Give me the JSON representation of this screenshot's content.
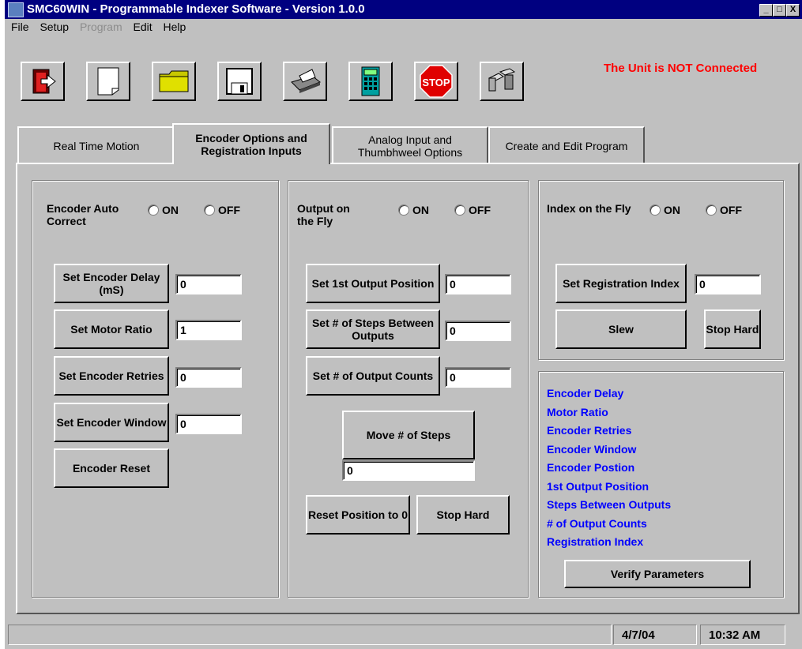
{
  "window": {
    "title": "SMC60WIN - Programmable Indexer Software - Version 1.0.0",
    "controls": [
      "_",
      "□",
      "X"
    ]
  },
  "menu": {
    "items": [
      {
        "label": "File",
        "enabled": true
      },
      {
        "label": "Setup",
        "enabled": true
      },
      {
        "label": "Program",
        "enabled": false
      },
      {
        "label": "Edit",
        "enabled": true
      },
      {
        "label": "Help",
        "enabled": true
      }
    ]
  },
  "toolbar": {
    "buttons": [
      "exit-icon",
      "new-file-icon",
      "open-folder-icon",
      "save-disk-icon",
      "printer-icon",
      "calculator-icon",
      "stop-sign-icon",
      "communication-icon"
    ],
    "stop_text": "STOP"
  },
  "connection_status": "The Unit is NOT Connected",
  "tabs": [
    {
      "label": "Real Time Motion",
      "active": false
    },
    {
      "label": "Encoder Options and Registration Inputs",
      "active": true
    },
    {
      "label": "Analog Input and Thumbhweel Options",
      "active": false
    },
    {
      "label": "Create and Edit Program",
      "active": false
    }
  ],
  "radio_on": "ON",
  "radio_off": "OFF",
  "encoder_panel": {
    "title": "Encoder Auto Correct",
    "buttons": [
      {
        "label": "Set Encoder Delay (mS)",
        "value": "0"
      },
      {
        "label": "Set Motor Ratio",
        "value": "1"
      },
      {
        "label": "Set Encoder Retries",
        "value": "0"
      },
      {
        "label": "Set Encoder Window",
        "value": "0"
      }
    ],
    "reset_label": "Encoder Reset"
  },
  "output_panel": {
    "title": "Output on the Fly",
    "buttons": [
      {
        "label": "Set 1st Output Position",
        "value": "0"
      },
      {
        "label": "Set # of Steps Between Outputs",
        "value": "0"
      },
      {
        "label": "Set # of Output Counts",
        "value": "0"
      }
    ],
    "move_label": "Move # of Steps",
    "move_value": "0",
    "reset_label": "Reset Position to 0",
    "stop_label": "Stop Hard"
  },
  "index_panel": {
    "title": "Index on the Fly",
    "set_label": "Set Registration Index",
    "set_value": "0",
    "slew_label": "Slew",
    "stop_label": "Stop Hard"
  },
  "params_panel": {
    "items": [
      "Encoder Delay",
      "Motor Ratio",
      "Encoder Retries",
      "Encoder Window",
      "Encoder Postion",
      "1st Output Position",
      "Steps Between Outputs",
      "# of Output Counts",
      "Registration Index"
    ],
    "verify_label": "Verify Parameters"
  },
  "statusbar": {
    "date": "4/7/04",
    "time": "10:32 AM"
  }
}
